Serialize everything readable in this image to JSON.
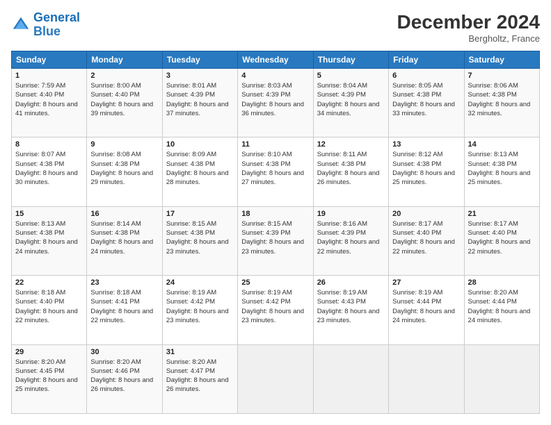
{
  "logo": {
    "line1": "General",
    "line2": "Blue"
  },
  "title": "December 2024",
  "location": "Bergholtz, France",
  "days_header": [
    "Sunday",
    "Monday",
    "Tuesday",
    "Wednesday",
    "Thursday",
    "Friday",
    "Saturday"
  ],
  "weeks": [
    [
      {
        "day": "1",
        "sunrise": "Sunrise: 7:59 AM",
        "sunset": "Sunset: 4:40 PM",
        "daylight": "Daylight: 8 hours and 41 minutes."
      },
      {
        "day": "2",
        "sunrise": "Sunrise: 8:00 AM",
        "sunset": "Sunset: 4:40 PM",
        "daylight": "Daylight: 8 hours and 39 minutes."
      },
      {
        "day": "3",
        "sunrise": "Sunrise: 8:01 AM",
        "sunset": "Sunset: 4:39 PM",
        "daylight": "Daylight: 8 hours and 37 minutes."
      },
      {
        "day": "4",
        "sunrise": "Sunrise: 8:03 AM",
        "sunset": "Sunset: 4:39 PM",
        "daylight": "Daylight: 8 hours and 36 minutes."
      },
      {
        "day": "5",
        "sunrise": "Sunrise: 8:04 AM",
        "sunset": "Sunset: 4:39 PM",
        "daylight": "Daylight: 8 hours and 34 minutes."
      },
      {
        "day": "6",
        "sunrise": "Sunrise: 8:05 AM",
        "sunset": "Sunset: 4:38 PM",
        "daylight": "Daylight: 8 hours and 33 minutes."
      },
      {
        "day": "7",
        "sunrise": "Sunrise: 8:06 AM",
        "sunset": "Sunset: 4:38 PM",
        "daylight": "Daylight: 8 hours and 32 minutes."
      }
    ],
    [
      {
        "day": "8",
        "sunrise": "Sunrise: 8:07 AM",
        "sunset": "Sunset: 4:38 PM",
        "daylight": "Daylight: 8 hours and 30 minutes."
      },
      {
        "day": "9",
        "sunrise": "Sunrise: 8:08 AM",
        "sunset": "Sunset: 4:38 PM",
        "daylight": "Daylight: 8 hours and 29 minutes."
      },
      {
        "day": "10",
        "sunrise": "Sunrise: 8:09 AM",
        "sunset": "Sunset: 4:38 PM",
        "daylight": "Daylight: 8 hours and 28 minutes."
      },
      {
        "day": "11",
        "sunrise": "Sunrise: 8:10 AM",
        "sunset": "Sunset: 4:38 PM",
        "daylight": "Daylight: 8 hours and 27 minutes."
      },
      {
        "day": "12",
        "sunrise": "Sunrise: 8:11 AM",
        "sunset": "Sunset: 4:38 PM",
        "daylight": "Daylight: 8 hours and 26 minutes."
      },
      {
        "day": "13",
        "sunrise": "Sunrise: 8:12 AM",
        "sunset": "Sunset: 4:38 PM",
        "daylight": "Daylight: 8 hours and 25 minutes."
      },
      {
        "day": "14",
        "sunrise": "Sunrise: 8:13 AM",
        "sunset": "Sunset: 4:38 PM",
        "daylight": "Daylight: 8 hours and 25 minutes."
      }
    ],
    [
      {
        "day": "15",
        "sunrise": "Sunrise: 8:13 AM",
        "sunset": "Sunset: 4:38 PM",
        "daylight": "Daylight: 8 hours and 24 minutes."
      },
      {
        "day": "16",
        "sunrise": "Sunrise: 8:14 AM",
        "sunset": "Sunset: 4:38 PM",
        "daylight": "Daylight: 8 hours and 24 minutes."
      },
      {
        "day": "17",
        "sunrise": "Sunrise: 8:15 AM",
        "sunset": "Sunset: 4:38 PM",
        "daylight": "Daylight: 8 hours and 23 minutes."
      },
      {
        "day": "18",
        "sunrise": "Sunrise: 8:15 AM",
        "sunset": "Sunset: 4:39 PM",
        "daylight": "Daylight: 8 hours and 23 minutes."
      },
      {
        "day": "19",
        "sunrise": "Sunrise: 8:16 AM",
        "sunset": "Sunset: 4:39 PM",
        "daylight": "Daylight: 8 hours and 22 minutes."
      },
      {
        "day": "20",
        "sunrise": "Sunrise: 8:17 AM",
        "sunset": "Sunset: 4:40 PM",
        "daylight": "Daylight: 8 hours and 22 minutes."
      },
      {
        "day": "21",
        "sunrise": "Sunrise: 8:17 AM",
        "sunset": "Sunset: 4:40 PM",
        "daylight": "Daylight: 8 hours and 22 minutes."
      }
    ],
    [
      {
        "day": "22",
        "sunrise": "Sunrise: 8:18 AM",
        "sunset": "Sunset: 4:40 PM",
        "daylight": "Daylight: 8 hours and 22 minutes."
      },
      {
        "day": "23",
        "sunrise": "Sunrise: 8:18 AM",
        "sunset": "Sunset: 4:41 PM",
        "daylight": "Daylight: 8 hours and 22 minutes."
      },
      {
        "day": "24",
        "sunrise": "Sunrise: 8:19 AM",
        "sunset": "Sunset: 4:42 PM",
        "daylight": "Daylight: 8 hours and 23 minutes."
      },
      {
        "day": "25",
        "sunrise": "Sunrise: 8:19 AM",
        "sunset": "Sunset: 4:42 PM",
        "daylight": "Daylight: 8 hours and 23 minutes."
      },
      {
        "day": "26",
        "sunrise": "Sunrise: 8:19 AM",
        "sunset": "Sunset: 4:43 PM",
        "daylight": "Daylight: 8 hours and 23 minutes."
      },
      {
        "day": "27",
        "sunrise": "Sunrise: 8:19 AM",
        "sunset": "Sunset: 4:44 PM",
        "daylight": "Daylight: 8 hours and 24 minutes."
      },
      {
        "day": "28",
        "sunrise": "Sunrise: 8:20 AM",
        "sunset": "Sunset: 4:44 PM",
        "daylight": "Daylight: 8 hours and 24 minutes."
      }
    ],
    [
      {
        "day": "29",
        "sunrise": "Sunrise: 8:20 AM",
        "sunset": "Sunset: 4:45 PM",
        "daylight": "Daylight: 8 hours and 25 minutes."
      },
      {
        "day": "30",
        "sunrise": "Sunrise: 8:20 AM",
        "sunset": "Sunset: 4:46 PM",
        "daylight": "Daylight: 8 hours and 26 minutes."
      },
      {
        "day": "31",
        "sunrise": "Sunrise: 8:20 AM",
        "sunset": "Sunset: 4:47 PM",
        "daylight": "Daylight: 8 hours and 26 minutes."
      },
      null,
      null,
      null,
      null
    ]
  ]
}
